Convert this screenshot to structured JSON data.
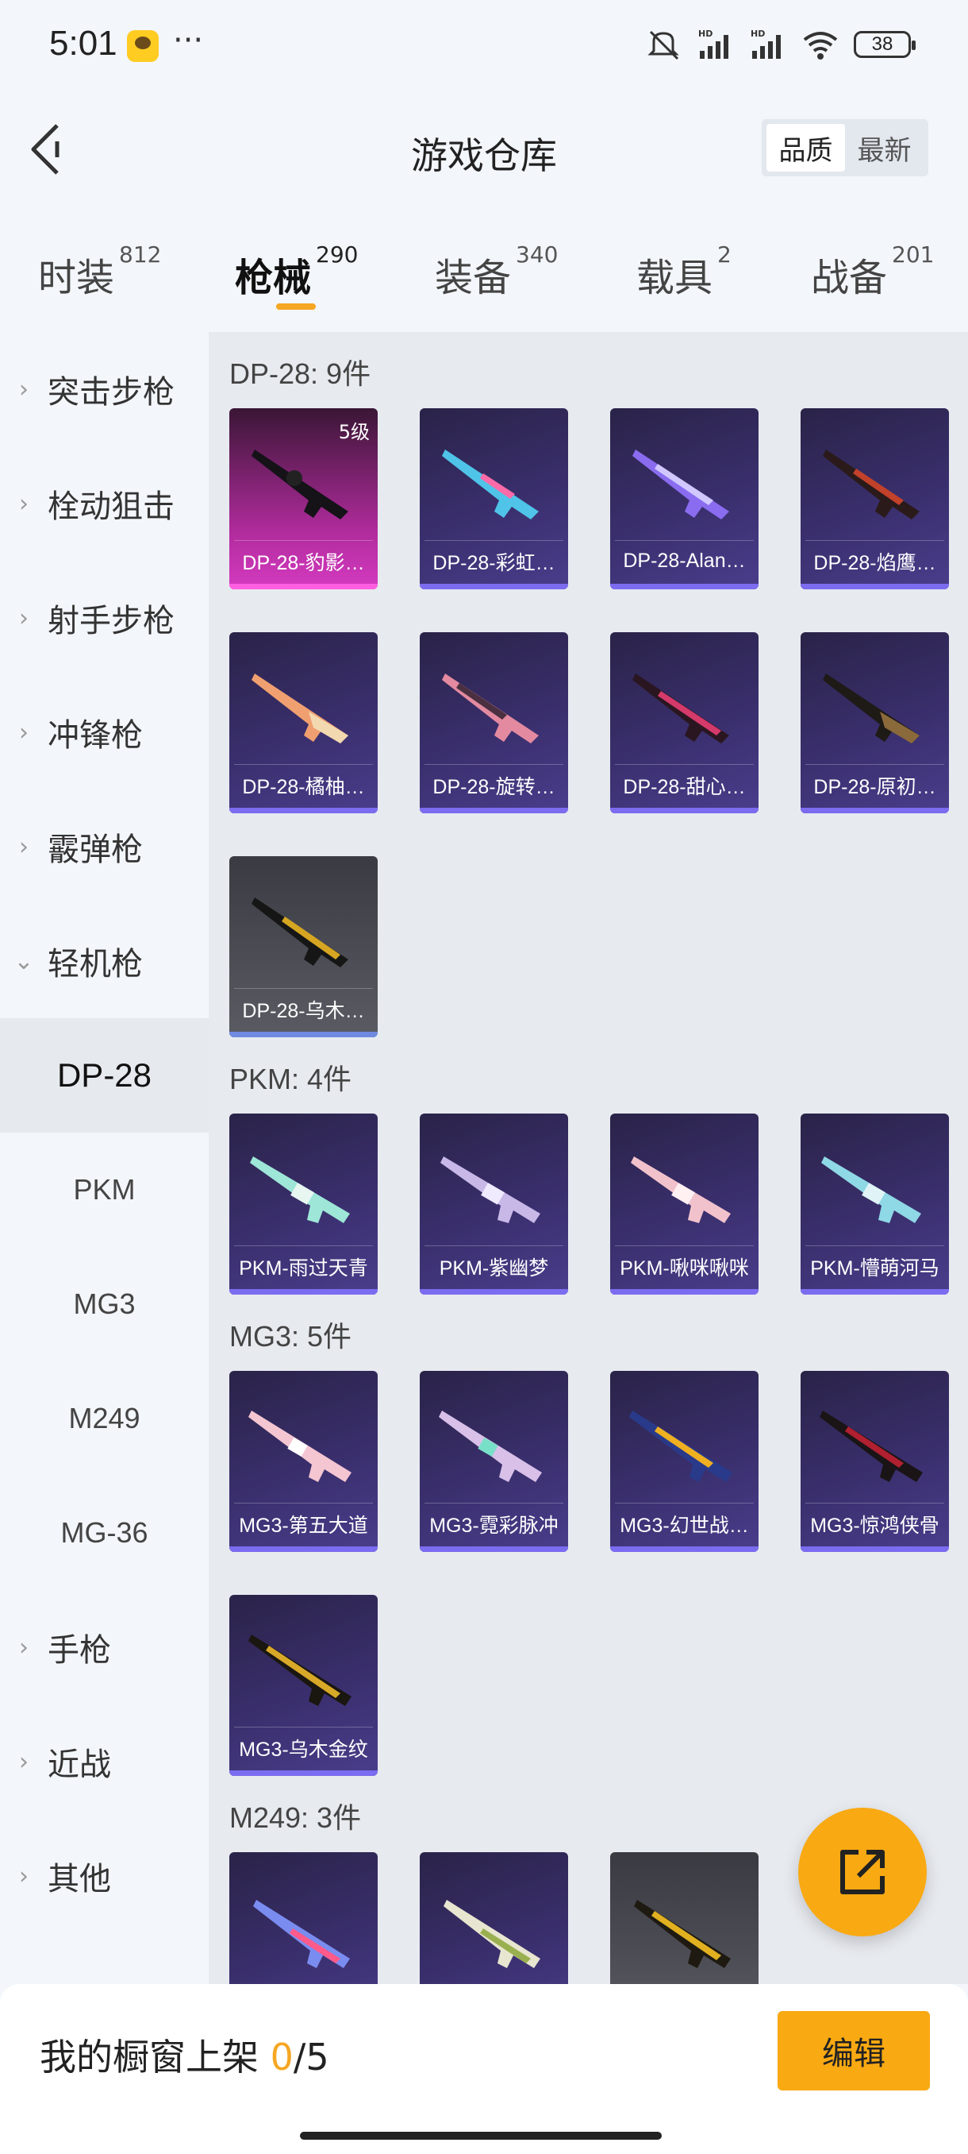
{
  "statusbar": {
    "time": "5:01",
    "dots": "···",
    "battery": "38"
  },
  "header": {
    "title": "游戏仓库",
    "sort": [
      "品质",
      "最新"
    ]
  },
  "tabs": [
    {
      "label": "时装",
      "count": "812"
    },
    {
      "label": "枪械",
      "count": "290"
    },
    {
      "label": "装备",
      "count": "340"
    },
    {
      "label": "载具",
      "count": "2"
    },
    {
      "label": "战备",
      "count": "201"
    }
  ],
  "sidebar": {
    "categories": [
      "突击步枪",
      "栓动狙击",
      "射手步枪",
      "冲锋枪",
      "霰弹枪",
      "轻机枪",
      "手枪",
      "近战",
      "其他"
    ],
    "subs": [
      "DP-28",
      "PKM",
      "MG3",
      "M249",
      "MG-36"
    ]
  },
  "sections": [
    {
      "title": "DP-28: 9件",
      "items": [
        "DP-28-豹影…",
        "DP-28-彩虹…",
        "DP-28-Alan…",
        "DP-28-焰鹰…",
        "DP-28-橘柚…",
        "DP-28-旋转…",
        "DP-28-甜心…",
        "DP-28-原初…",
        "DP-28-乌木…"
      ],
      "level": "5级"
    },
    {
      "title": "PKM: 4件",
      "items": [
        "PKM-雨过天青",
        "PKM-紫幽梦",
        "PKM-啾咪啾咪",
        "PKM-懵萌河马"
      ]
    },
    {
      "title": "MG3: 5件",
      "items": [
        "MG3-第五大道",
        "MG3-霓彩脉冲",
        "MG3-幻世战…",
        "MG3-惊鸿侠骨",
        "MG3-乌木金纹"
      ]
    },
    {
      "title": "M249: 3件",
      "items": []
    }
  ],
  "bottombar": {
    "prefix": "我的橱窗上架 ",
    "current": "0",
    "suffix": "/5",
    "edit": "编辑"
  },
  "colors": {
    "accent": "#f9a912",
    "card_purple": "#3a2f6d",
    "card_pink": "#c02fad",
    "card_gray": "#55565d"
  }
}
